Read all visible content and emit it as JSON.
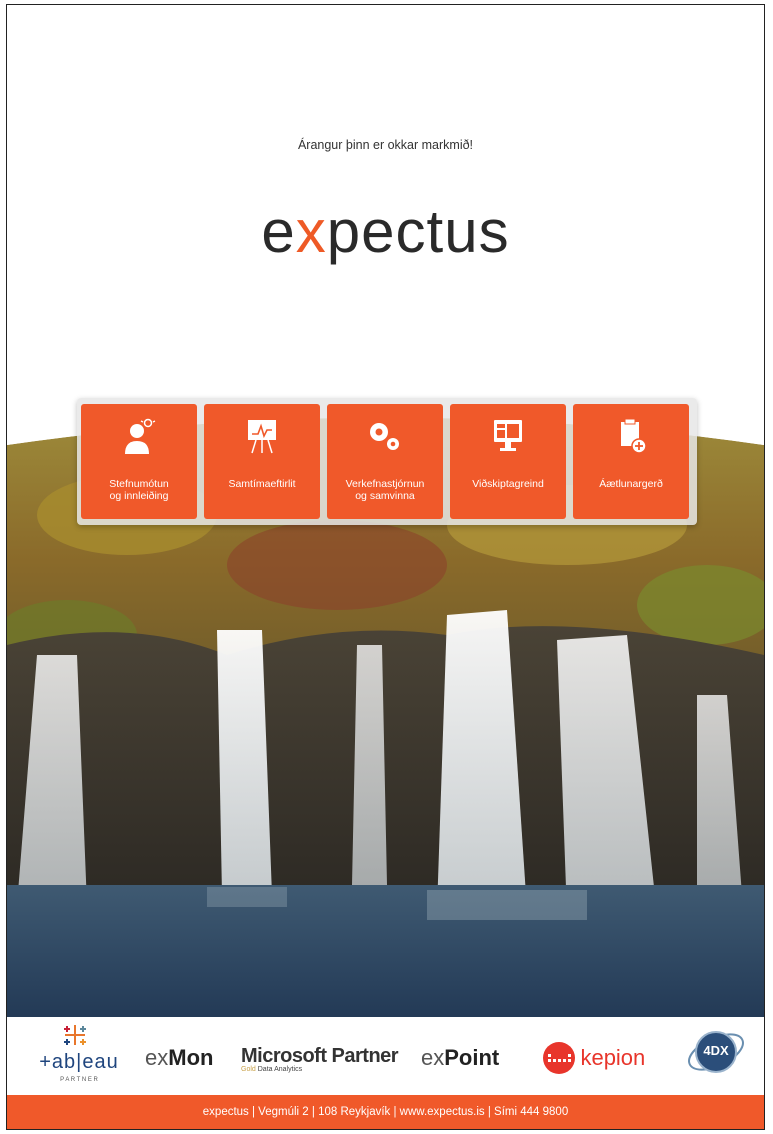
{
  "tagline": "Árangur þinn er okkar markmið!",
  "logo": {
    "pre": "e",
    "x": "x",
    "post": "pectus"
  },
  "services": [
    {
      "label": "Stefnumótun\nog innleiðing",
      "icon": "person-idea-icon"
    },
    {
      "label": "Samtímaeftirlit",
      "icon": "monitor-board-icon"
    },
    {
      "label": "Verkefnastjórnun\nog samvinna",
      "icon": "gears-icon"
    },
    {
      "label": "Viðskiptagreind",
      "icon": "dashboard-monitor-icon"
    },
    {
      "label": "Áætlunargerð",
      "icon": "clipboard-add-icon"
    }
  ],
  "partners": {
    "tableau": "+ab|eau",
    "tableau_sub": "P A R T N E R",
    "exmon_pre": "ex",
    "exmon_post": "Mon",
    "microsoft": "Microsoft Partner",
    "microsoft_gold": "Gold",
    "microsoft_sub": "Data Analytics",
    "expoint_pre": "ex",
    "expoint_post": "Point",
    "kepion": "kepion",
    "fourdx": "4DX"
  },
  "footer": "expectus | Vegmúli 2 | 108 Reykjavík | www.expectus.is | Sími 444 9800",
  "colors": {
    "accent": "#f0592a",
    "text": "#2a2a2a"
  }
}
